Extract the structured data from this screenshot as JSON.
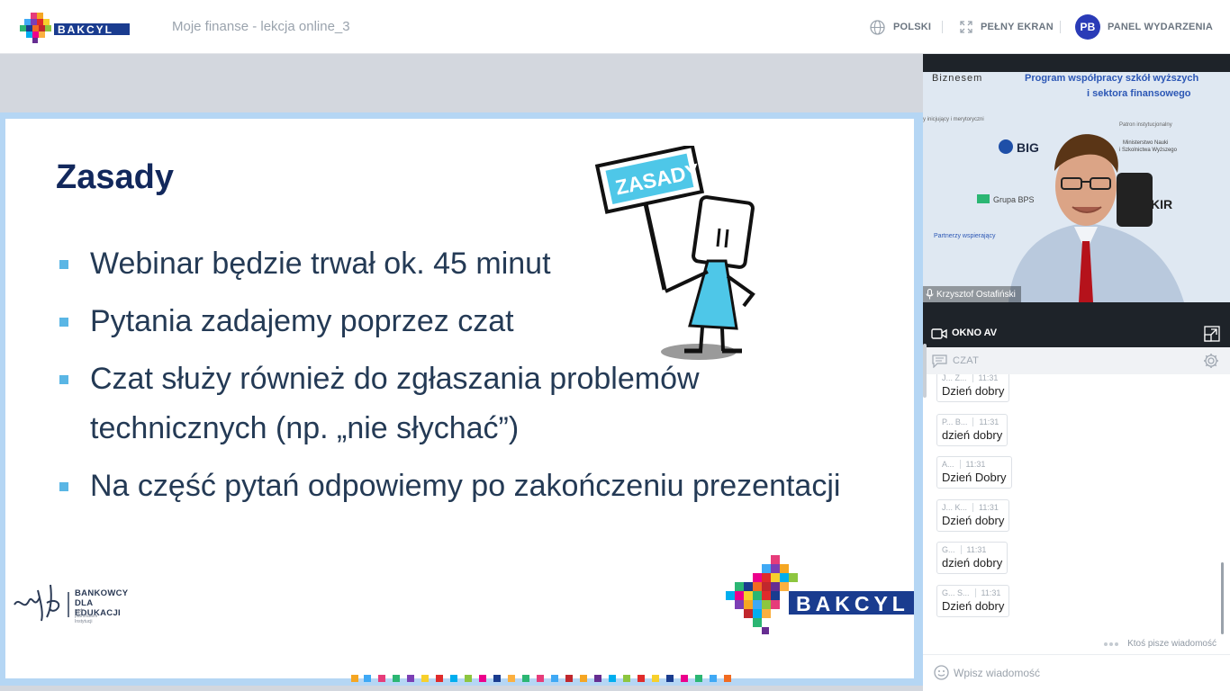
{
  "header": {
    "event_title": "Moje finanse - lekcja online_3",
    "language_label": "POLSKI",
    "fullscreen_label": "PEŁNY EKRAN",
    "avatar_initials": "PB",
    "event_panel_label": "PANEL WYDARZENIA",
    "logo_text": "BAKCYL"
  },
  "slide": {
    "title": "Zasady",
    "sign_text": "ZASADY",
    "bullets": [
      "Webinar będzie trwał ok. 45 minut",
      "Pytania zadajemy poprzez czat",
      "Czat służy również do zgłaszania problemów",
      "technicznych (np. „nie słychać”)",
      "Na część pytań odpowiemy po zakończeniu prezentacji"
    ],
    "footer_org_line1": "BANKOWCY",
    "footer_org_line2": "DLA EDUKACJI",
    "footer_org_sub": "pod patronatem Instytucji",
    "footer_logo_text": "BAKCYL"
  },
  "video": {
    "speaker_name": "Krzysztof Ostafiński",
    "bg_text": {
      "program": "Program współpracy szkół wyższych",
      "sector": "i sektora finansowego",
      "biznes": "Biznesem",
      "inicjujacy": "y inicjujący i merytoryczni",
      "patron": "Patron instytucjonalny",
      "ministerstwo": "Ministerstwo Nauki",
      "szkolnictwa": "i Szkolnictwa Wyższego",
      "big": "BIG",
      "grupa": "Grupa BPS",
      "partnerzy": "Partnerzy wspierający",
      "kir": "KIR"
    }
  },
  "av_window": {
    "label": "OKNO AV"
  },
  "chat": {
    "title": "CZAT",
    "messages": [
      {
        "author": "J... Z...",
        "time": "11:31",
        "text": "Dzień dobry"
      },
      {
        "author": "P... B...",
        "time": "11:31",
        "text": "dzień dobry"
      },
      {
        "author": "A...",
        "time": "11:31",
        "text": "Dzień Dobry"
      },
      {
        "author": "J... K...",
        "time": "11:31",
        "text": "Dzień dobry"
      },
      {
        "author": "G...",
        "time": "11:31",
        "text": "dzień dobry"
      },
      {
        "author": "G... S...",
        "time": "11:31",
        "text": "Dzień dobry"
      }
    ],
    "typing_indicator": "Ktoś pisze wiadomość",
    "input_placeholder": "Wpisz wiadomość"
  },
  "colors": {
    "accent_blue": "#2a3bb7",
    "slide_border": "#b5d6f4",
    "bullet": "#5ab6e5",
    "title": "#12285c"
  }
}
